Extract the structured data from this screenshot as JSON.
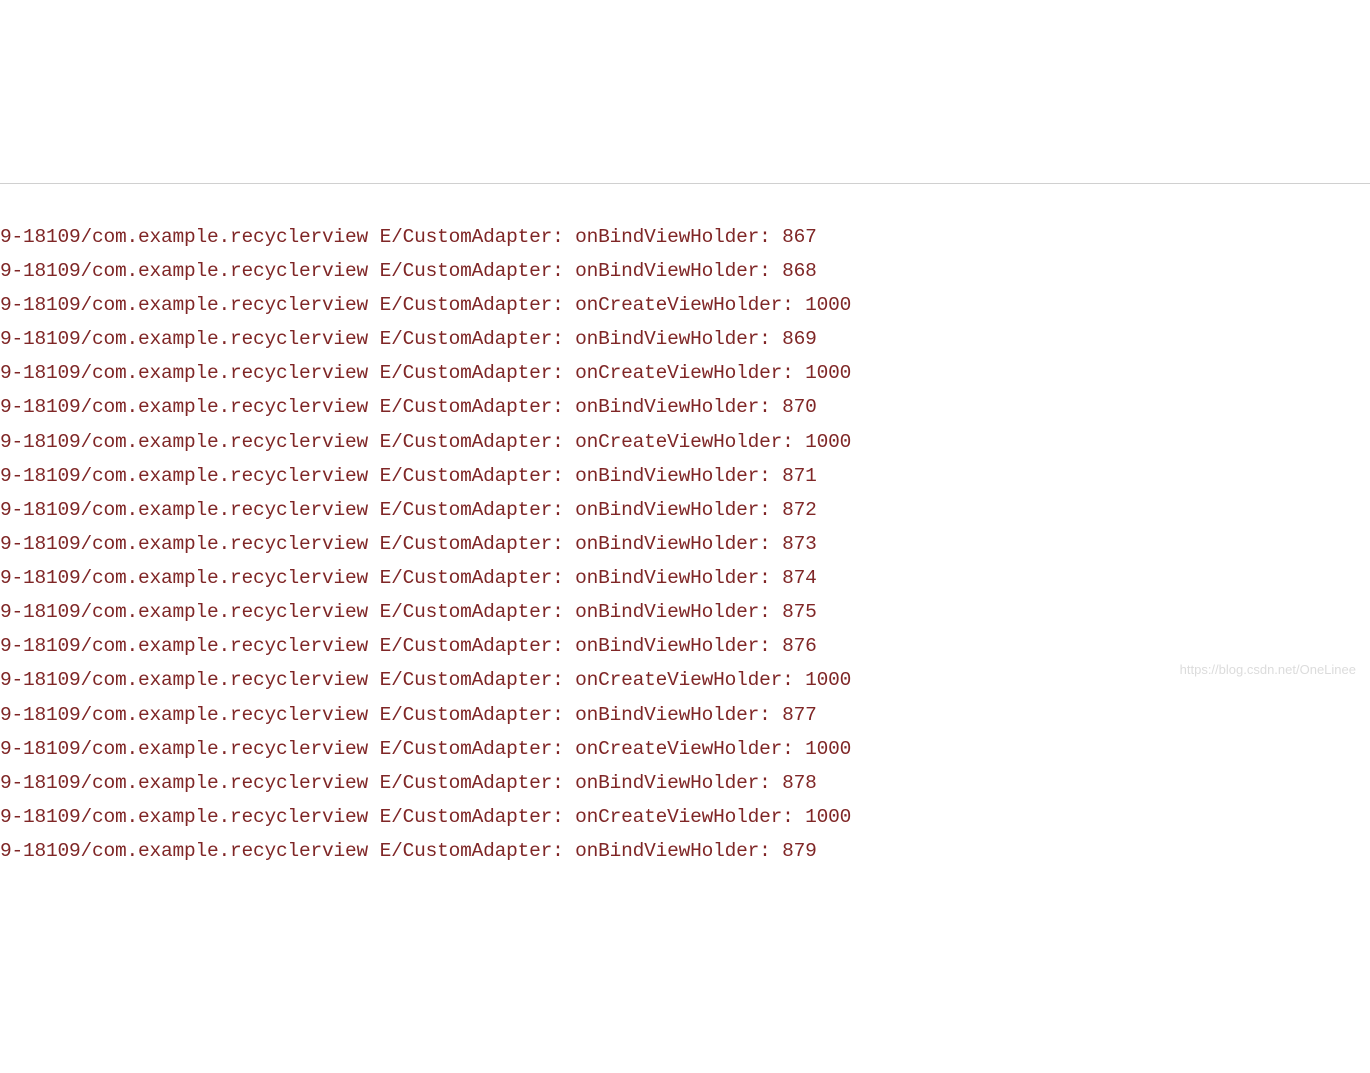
{
  "watermark": "https://blog.csdn.net/OneLinee",
  "log": {
    "prefix": "9-18109/com.example.recyclerview E/CustomAdapter: ",
    "top_partial_line": "                                                                       ",
    "lines": [
      {
        "method": "onBindViewHolder",
        "value": 867
      },
      {
        "method": "onBindViewHolder",
        "value": 868
      },
      {
        "method": "onCreateViewHolder",
        "value": 1000
      },
      {
        "method": "onBindViewHolder",
        "value": 869
      },
      {
        "method": "onCreateViewHolder",
        "value": 1000
      },
      {
        "method": "onBindViewHolder",
        "value": 870
      },
      {
        "method": "onCreateViewHolder",
        "value": 1000
      },
      {
        "method": "onBindViewHolder",
        "value": 871
      },
      {
        "method": "onBindViewHolder",
        "value": 872
      },
      {
        "method": "onBindViewHolder",
        "value": 873
      },
      {
        "method": "onBindViewHolder",
        "value": 874
      },
      {
        "method": "onBindViewHolder",
        "value": 875
      },
      {
        "method": "onBindViewHolder",
        "value": 876
      },
      {
        "method": "onCreateViewHolder",
        "value": 1000
      },
      {
        "method": "onBindViewHolder",
        "value": 877
      },
      {
        "method": "onCreateViewHolder",
        "value": 1000
      },
      {
        "method": "onBindViewHolder",
        "value": 878
      },
      {
        "method": "onCreateViewHolder",
        "value": 1000
      },
      {
        "method": "onBindViewHolder",
        "value": 879
      }
    ]
  }
}
